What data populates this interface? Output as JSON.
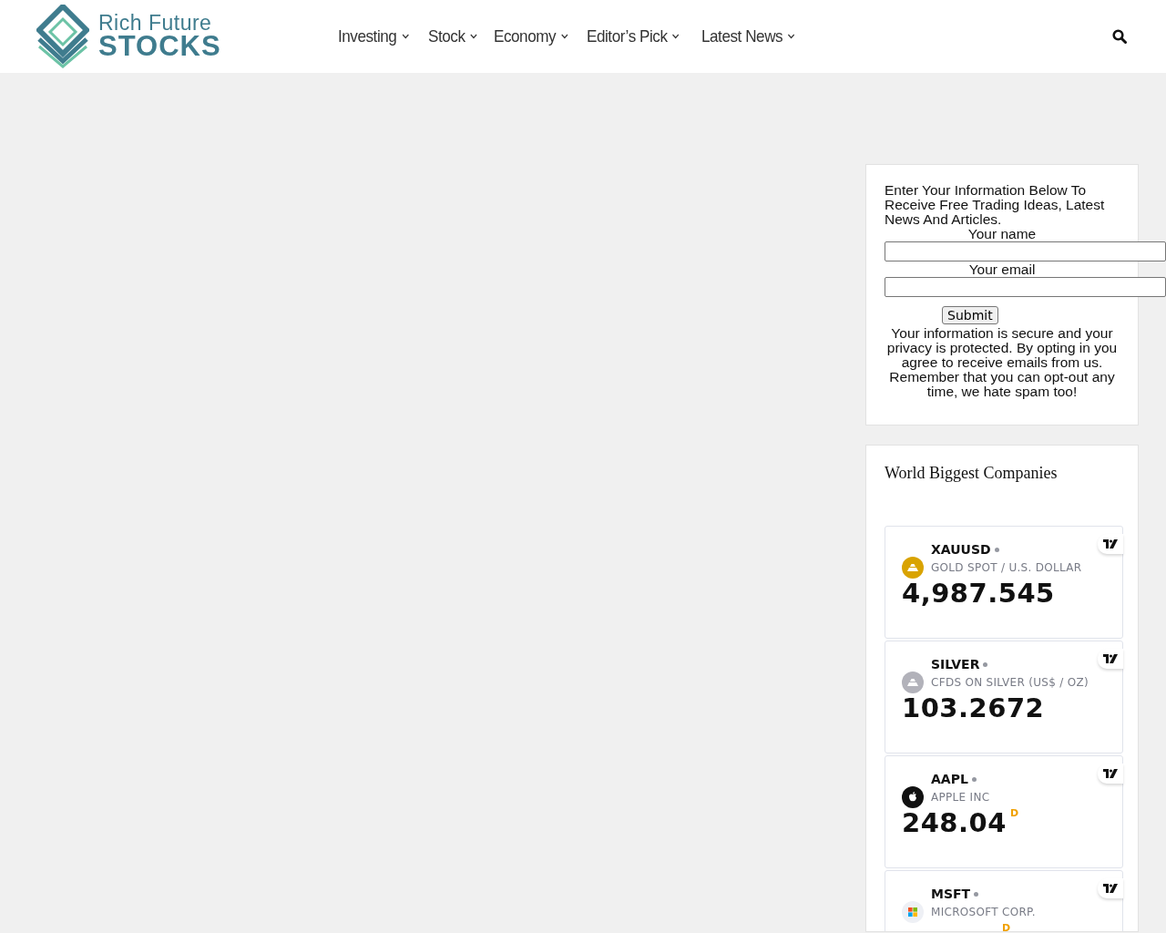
{
  "logo": {
    "line_1": "Rich Future",
    "line_2": "STOCKS"
  },
  "nav": [
    {
      "label": "Investing",
      "has_dropdown": true
    },
    {
      "label": "Stock",
      "has_dropdown": true
    },
    {
      "label": "Economy",
      "has_dropdown": true
    },
    {
      "label": "Editor’s Pick",
      "has_dropdown": true
    },
    {
      "label": "Latest News",
      "has_dropdown": true
    }
  ],
  "signup": {
    "intro": "Enter Your Information Below To Receive Free Trading Ideas, Latest News And Articles.",
    "name_label": "Your name",
    "email_label": "Your email",
    "submit": "Submit",
    "notice": "Your information is secure and your privacy is protected. By opting in you agree to receive emails from us. Remember that you can opt-out any time, we hate spam too!"
  },
  "companies": {
    "title": "World Biggest Companies",
    "tickers": [
      {
        "kind": "gold",
        "symbol": "XAUUSD",
        "name": "GOLD SPOT / U.S. DOLLAR",
        "price": "4,987.545"
      },
      {
        "kind": "silver",
        "symbol": "SILVER",
        "name": "CFDS ON SILVER (US$ / OZ)",
        "price": "103.2672"
      },
      {
        "kind": "apple",
        "symbol": "AAPL",
        "name": "APPLE INC",
        "price": "248.04",
        "flag": "D"
      },
      {
        "kind": "microsoft",
        "symbol": "MSFT",
        "name": "MICROSOFT CORP.",
        "flag": "D"
      }
    ]
  }
}
